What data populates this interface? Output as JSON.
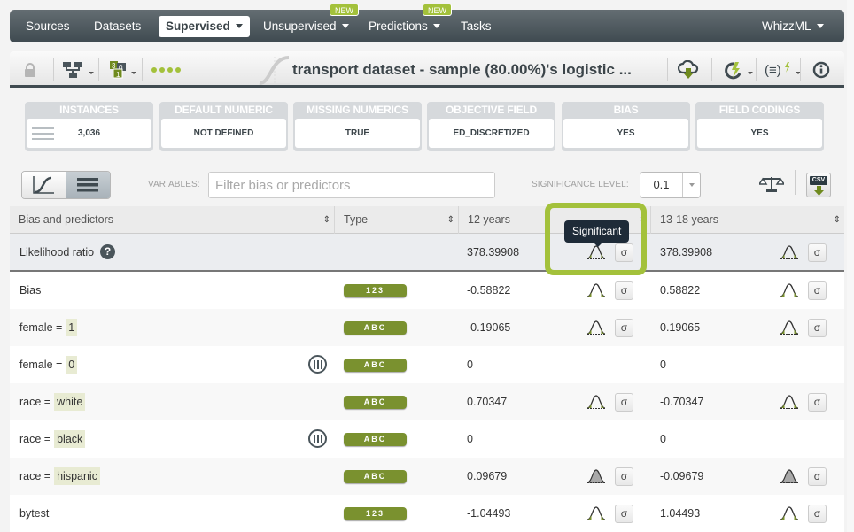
{
  "nav": {
    "items": [
      {
        "label": "Sources",
        "dropdown": false,
        "active": false,
        "badge": null
      },
      {
        "label": "Datasets",
        "dropdown": false,
        "active": false,
        "badge": null
      },
      {
        "label": "Supervised",
        "dropdown": true,
        "active": true,
        "badge": null
      },
      {
        "label": "Unsupervised",
        "dropdown": true,
        "active": false,
        "badge": "NEW"
      },
      {
        "label": "Predictions",
        "dropdown": true,
        "active": false,
        "badge": "NEW"
      },
      {
        "label": "Tasks",
        "dropdown": false,
        "active": false,
        "badge": null
      }
    ],
    "right": {
      "label": "WhizzML"
    }
  },
  "titlebar": {
    "title": "transport dataset - sample (80.00%)'s logistic ...",
    "icons": [
      "lock-icon",
      "model-tree-icon",
      "model-types-icon",
      "progress-dots-icon",
      "logistic-curve-icon",
      "cloud-download-icon",
      "reprocess-icon",
      "formula-icon",
      "info-icon"
    ]
  },
  "summary": [
    {
      "label": "INSTANCES",
      "value": "3,036"
    },
    {
      "label": "DEFAULT NUMERIC",
      "value": "NOT DEFINED"
    },
    {
      "label": "MISSING NUMERICS",
      "value": "TRUE"
    },
    {
      "label": "OBJECTIVE FIELD",
      "value": "ED_DISCRETIZED"
    },
    {
      "label": "BIAS",
      "value": "YES"
    },
    {
      "label": "FIELD CODINGS",
      "value": "YES"
    }
  ],
  "toolbar": {
    "variables_label": "VARIABLES:",
    "filter_placeholder": "Filter bias or predictors",
    "filter_value": "",
    "significance_label": "SIGNIFICANCE LEVEL:",
    "significance_value": "0.1",
    "csv_label": "CSV"
  },
  "table": {
    "columns": [
      "Bias and predictors",
      "Type",
      "12 years",
      "13-18 years"
    ],
    "likelihood": {
      "label": "Likelihood ratio",
      "c1": "378.39908",
      "c2": "378.39908"
    },
    "rows": [
      {
        "name": "Bias",
        "chip": null,
        "type": "123",
        "coding": false,
        "c1": "-0.58822",
        "c2": "0.58822",
        "sig": "significant"
      },
      {
        "name": "female =",
        "chip": "1",
        "type": "ABC",
        "coding": false,
        "c1": "-0.19065",
        "c2": "0.19065",
        "sig": "significant"
      },
      {
        "name": "female =",
        "chip": "0",
        "type": "ABC",
        "coding": true,
        "c1": "0",
        "c2": "0",
        "sig": "none"
      },
      {
        "name": "race =",
        "chip": "white",
        "type": "ABC",
        "coding": false,
        "c1": "0.70347",
        "c2": "-0.70347",
        "sig": "significant"
      },
      {
        "name": "race =",
        "chip": "black",
        "type": "ABC",
        "coding": true,
        "c1": "0",
        "c2": "0",
        "sig": "none"
      },
      {
        "name": "race =",
        "chip": "hispanic",
        "type": "ABC",
        "coding": false,
        "c1": "0.09679",
        "c2": "-0.09679",
        "sig": "not-significant"
      },
      {
        "name": "bytest",
        "chip": null,
        "type": "123",
        "coding": false,
        "c1": "-1.04493",
        "c2": "1.04493",
        "sig": "significant"
      }
    ]
  },
  "tooltip": {
    "text": "Significant"
  },
  "colors": {
    "accent": "#a3c13b",
    "type_badge": "#7a912f",
    "nav_dark": "#3f4a50",
    "tooltip_bg": "#1e2b38"
  }
}
